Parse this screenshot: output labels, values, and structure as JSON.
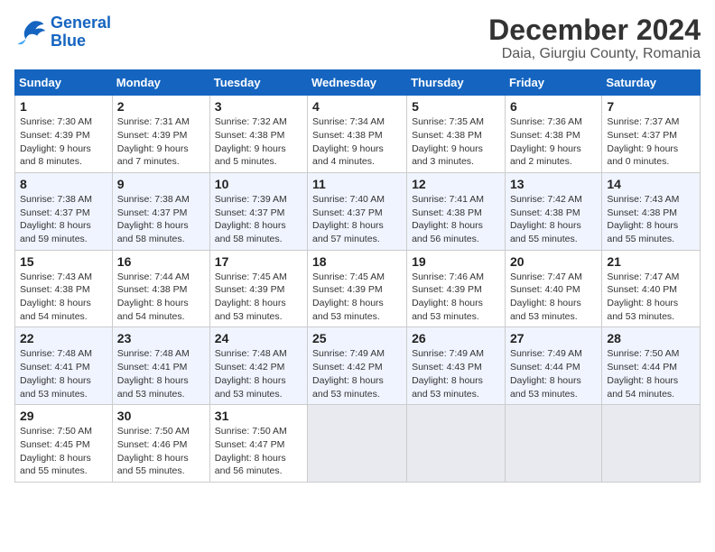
{
  "header": {
    "logo_line1": "General",
    "logo_line2": "Blue",
    "main_title": "December 2024",
    "sub_title": "Daia, Giurgiu County, Romania"
  },
  "calendar": {
    "columns": [
      "Sunday",
      "Monday",
      "Tuesday",
      "Wednesday",
      "Thursday",
      "Friday",
      "Saturday"
    ],
    "weeks": [
      [
        {
          "day": "1",
          "sunrise": "Sunrise: 7:30 AM",
          "sunset": "Sunset: 4:39 PM",
          "daylight": "Daylight: 9 hours and 8 minutes."
        },
        {
          "day": "2",
          "sunrise": "Sunrise: 7:31 AM",
          "sunset": "Sunset: 4:39 PM",
          "daylight": "Daylight: 9 hours and 7 minutes."
        },
        {
          "day": "3",
          "sunrise": "Sunrise: 7:32 AM",
          "sunset": "Sunset: 4:38 PM",
          "daylight": "Daylight: 9 hours and 5 minutes."
        },
        {
          "day": "4",
          "sunrise": "Sunrise: 7:34 AM",
          "sunset": "Sunset: 4:38 PM",
          "daylight": "Daylight: 9 hours and 4 minutes."
        },
        {
          "day": "5",
          "sunrise": "Sunrise: 7:35 AM",
          "sunset": "Sunset: 4:38 PM",
          "daylight": "Daylight: 9 hours and 3 minutes."
        },
        {
          "day": "6",
          "sunrise": "Sunrise: 7:36 AM",
          "sunset": "Sunset: 4:38 PM",
          "daylight": "Daylight: 9 hours and 2 minutes."
        },
        {
          "day": "7",
          "sunrise": "Sunrise: 7:37 AM",
          "sunset": "Sunset: 4:37 PM",
          "daylight": "Daylight: 9 hours and 0 minutes."
        }
      ],
      [
        {
          "day": "8",
          "sunrise": "Sunrise: 7:38 AM",
          "sunset": "Sunset: 4:37 PM",
          "daylight": "Daylight: 8 hours and 59 minutes."
        },
        {
          "day": "9",
          "sunrise": "Sunrise: 7:38 AM",
          "sunset": "Sunset: 4:37 PM",
          "daylight": "Daylight: 8 hours and 58 minutes."
        },
        {
          "day": "10",
          "sunrise": "Sunrise: 7:39 AM",
          "sunset": "Sunset: 4:37 PM",
          "daylight": "Daylight: 8 hours and 58 minutes."
        },
        {
          "day": "11",
          "sunrise": "Sunrise: 7:40 AM",
          "sunset": "Sunset: 4:37 PM",
          "daylight": "Daylight: 8 hours and 57 minutes."
        },
        {
          "day": "12",
          "sunrise": "Sunrise: 7:41 AM",
          "sunset": "Sunset: 4:38 PM",
          "daylight": "Daylight: 8 hours and 56 minutes."
        },
        {
          "day": "13",
          "sunrise": "Sunrise: 7:42 AM",
          "sunset": "Sunset: 4:38 PM",
          "daylight": "Daylight: 8 hours and 55 minutes."
        },
        {
          "day": "14",
          "sunrise": "Sunrise: 7:43 AM",
          "sunset": "Sunset: 4:38 PM",
          "daylight": "Daylight: 8 hours and 55 minutes."
        }
      ],
      [
        {
          "day": "15",
          "sunrise": "Sunrise: 7:43 AM",
          "sunset": "Sunset: 4:38 PM",
          "daylight": "Daylight: 8 hours and 54 minutes."
        },
        {
          "day": "16",
          "sunrise": "Sunrise: 7:44 AM",
          "sunset": "Sunset: 4:38 PM",
          "daylight": "Daylight: 8 hours and 54 minutes."
        },
        {
          "day": "17",
          "sunrise": "Sunrise: 7:45 AM",
          "sunset": "Sunset: 4:39 PM",
          "daylight": "Daylight: 8 hours and 53 minutes."
        },
        {
          "day": "18",
          "sunrise": "Sunrise: 7:45 AM",
          "sunset": "Sunset: 4:39 PM",
          "daylight": "Daylight: 8 hours and 53 minutes."
        },
        {
          "day": "19",
          "sunrise": "Sunrise: 7:46 AM",
          "sunset": "Sunset: 4:39 PM",
          "daylight": "Daylight: 8 hours and 53 minutes."
        },
        {
          "day": "20",
          "sunrise": "Sunrise: 7:47 AM",
          "sunset": "Sunset: 4:40 PM",
          "daylight": "Daylight: 8 hours and 53 minutes."
        },
        {
          "day": "21",
          "sunrise": "Sunrise: 7:47 AM",
          "sunset": "Sunset: 4:40 PM",
          "daylight": "Daylight: 8 hours and 53 minutes."
        }
      ],
      [
        {
          "day": "22",
          "sunrise": "Sunrise: 7:48 AM",
          "sunset": "Sunset: 4:41 PM",
          "daylight": "Daylight: 8 hours and 53 minutes."
        },
        {
          "day": "23",
          "sunrise": "Sunrise: 7:48 AM",
          "sunset": "Sunset: 4:41 PM",
          "daylight": "Daylight: 8 hours and 53 minutes."
        },
        {
          "day": "24",
          "sunrise": "Sunrise: 7:48 AM",
          "sunset": "Sunset: 4:42 PM",
          "daylight": "Daylight: 8 hours and 53 minutes."
        },
        {
          "day": "25",
          "sunrise": "Sunrise: 7:49 AM",
          "sunset": "Sunset: 4:42 PM",
          "daylight": "Daylight: 8 hours and 53 minutes."
        },
        {
          "day": "26",
          "sunrise": "Sunrise: 7:49 AM",
          "sunset": "Sunset: 4:43 PM",
          "daylight": "Daylight: 8 hours and 53 minutes."
        },
        {
          "day": "27",
          "sunrise": "Sunrise: 7:49 AM",
          "sunset": "Sunset: 4:44 PM",
          "daylight": "Daylight: 8 hours and 53 minutes."
        },
        {
          "day": "28",
          "sunrise": "Sunrise: 7:50 AM",
          "sunset": "Sunset: 4:44 PM",
          "daylight": "Daylight: 8 hours and 54 minutes."
        }
      ],
      [
        {
          "day": "29",
          "sunrise": "Sunrise: 7:50 AM",
          "sunset": "Sunset: 4:45 PM",
          "daylight": "Daylight: 8 hours and 55 minutes."
        },
        {
          "day": "30",
          "sunrise": "Sunrise: 7:50 AM",
          "sunset": "Sunset: 4:46 PM",
          "daylight": "Daylight: 8 hours and 55 minutes."
        },
        {
          "day": "31",
          "sunrise": "Sunrise: 7:50 AM",
          "sunset": "Sunset: 4:47 PM",
          "daylight": "Daylight: 8 hours and 56 minutes."
        },
        null,
        null,
        null,
        null
      ]
    ]
  }
}
